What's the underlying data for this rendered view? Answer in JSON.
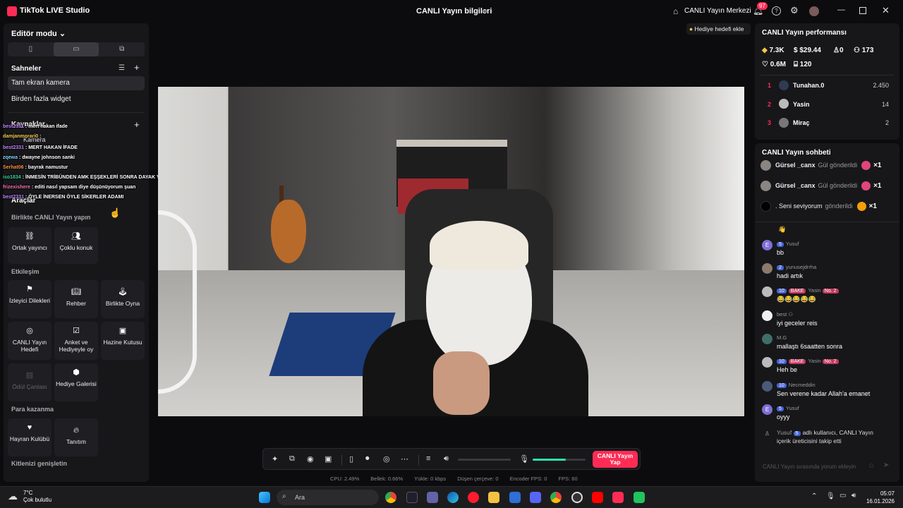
{
  "titlebar": {
    "app_name": "TikTok LIVE Studio",
    "center_title": "CANLI Yayın bilgileri",
    "live_center": "CANLI Yayın Merkezi",
    "notif_count": "97",
    "share_icon": "share-icon"
  },
  "left": {
    "editor_mode": "Editör modu",
    "scenes_title": "Sahneler",
    "scenes": [
      "Tam ekran kamera",
      "Birden fazla widget"
    ],
    "sources_title": "Kaynaklar",
    "source_item": "Kamera",
    "tools_title": "Araçlar",
    "sections": {
      "collab": "Birlikte CANLI Yayın yapın",
      "interaction": "Etkileşim",
      "earn": "Para kazanma",
      "grow": "Kitlenizi genişletin"
    },
    "tiles": {
      "cohost": "Ortak yayıncı",
      "multiguest": "Çoklu konuk",
      "viewer_requests": "İzleyici Dilekleri",
      "guide": "Rehber",
      "play_together": "Birlikte Oyna",
      "live_goal": "CANLI Yayın Hedefi",
      "poll": "Anket ve Hediyeyle oy",
      "treasure": "Hazine Kutusu",
      "reward_bag": "Ödül Çantası",
      "gift_gallery": "Hediye Galerisi",
      "fan_club": "Hayran Kulübü",
      "promotion": "Tanıtım"
    }
  },
  "overlay_chat": [
    {
      "user": "best2331",
      "text": ": mert hakan ifade"
    },
    {
      "user": "damjanmorari0",
      "text": ":"
    },
    {
      "user": "best2331",
      "text": ": MERT HAKAN İFADE"
    },
    {
      "user": "zqewa",
      "text": ": dwayne johnson sanki"
    },
    {
      "user": "Serhat06",
      "text": ": bayrak namustur"
    },
    {
      "user": "iso1834",
      "text": ": İNMESİN TRİBÜNDEN AMK EŞŞEKLERİ SONRA DAYAK YER ÖYLE TRABZONLU LAR AMK"
    },
    {
      "user": "frizexishere",
      "text": ": editi nasıl yapsam diye düşünüyorum şuan"
    },
    {
      "user": "best2331",
      "text": ": ÖYLE İNERSEN ÖYLE SİKERLER ADAMI"
    }
  ],
  "gift_goal": "Hediye hedefi ekle",
  "performance": {
    "title": "CANLI Yayın performansı",
    "coins": "7.3K",
    "revenue": "$29.44",
    "new_followers": "0",
    "viewers": "173",
    "likes": "0.6M",
    "gifters": "120",
    "ranking": [
      {
        "rank": "1",
        "name": "Tunahan.0",
        "value": "2.450"
      },
      {
        "rank": "2",
        "name": "Yasin",
        "value": "14"
      },
      {
        "rank": "3",
        "name": "Miraç",
        "value": "2"
      }
    ]
  },
  "chat": {
    "title": "CANLI Yayın sohbeti",
    "gifts": [
      {
        "name": "Gürsel _canx",
        "text": "Gül gönderildi",
        "count": "×1"
      },
      {
        "name": "Gürsel _canx",
        "text": "Gül gönderildi",
        "count": "×1"
      },
      {
        "name": ". Seni seviyorum",
        "text": "gönderildi",
        "count": "×1"
      }
    ],
    "messages": [
      {
        "avatar": "E",
        "level": "5",
        "user": "Yusuf",
        "text": "bb"
      },
      {
        "avatar": "",
        "level": "2",
        "user": "yunusejdrrha",
        "text": "hadi artık"
      },
      {
        "avatar": "",
        "level": "10",
        "user": "Yasin",
        "badge": "BAKE",
        "extra": "No. 2",
        "text": "😂😂😂😂😂"
      },
      {
        "avatar": "",
        "level": "",
        "user": "best",
        "text": "iyi geceler reis"
      },
      {
        "avatar": "",
        "level": "",
        "user": "M.G",
        "text": "mallaştı 6saatten sonra"
      },
      {
        "avatar": "",
        "level": "10",
        "user": "Yasin",
        "badge": "BAKE",
        "extra": "No. 2",
        "text": "Heh be"
      },
      {
        "avatar": "",
        "level": "10",
        "user": "Necmeddin",
        "text": "Sen verene kadar Allah'a emanet"
      },
      {
        "avatar": "E",
        "level": "5",
        "user": "Yusuf",
        "text": "oyyy"
      }
    ],
    "follow_note_user": "Yusuf",
    "follow_note_level": "5",
    "follow_note_text": "adlı kullanıcı, CANLI Yayın",
    "follow_note_text2": "içerik üreticisini takip etti",
    "input_placeholder": "CANLI Yayın sırasında yorum ekleyin"
  },
  "toolbar": {
    "go_live": "CANLI Yayın Yap"
  },
  "stats": {
    "cpu": "CPU:  2.49%",
    "memory": "Bellek:  0.66%",
    "upload": "Yükle:  0 kbps",
    "dropped": "Düşen çerçeve:  0",
    "encoder_fps": "Encoder FPS:  0",
    "fps": "FPS:  60"
  },
  "mic_level_fraction": 0.62,
  "taskbar": {
    "temp": "7°C",
    "weather": "Çok bulutlu",
    "search": "Ara",
    "time": "05:07",
    "date": "16.01.2026"
  },
  "colors": {
    "accent": "#fe2c55",
    "mic": "#2de3a5",
    "panel": "#17171a"
  }
}
